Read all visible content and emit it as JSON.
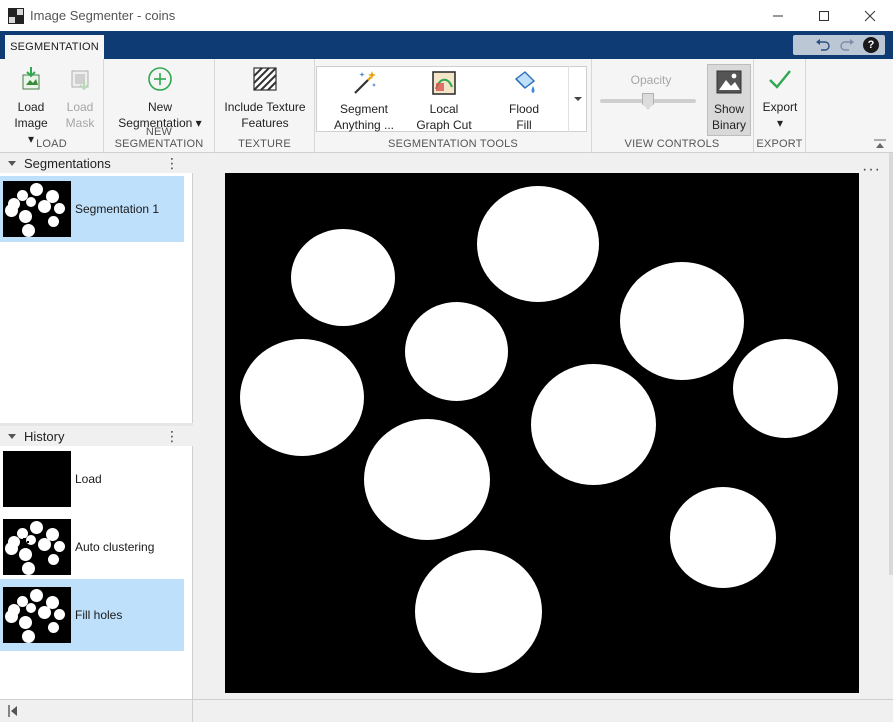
{
  "window": {
    "title": "Image Segmenter - coins"
  },
  "tabs": [
    {
      "label": "SEGMENTATION",
      "active": true
    }
  ],
  "ribbon": {
    "load": {
      "section_label": "LOAD",
      "load_image": {
        "line1": "Load",
        "line2": "Image ▾"
      },
      "load_mask": {
        "line1": "Load",
        "line2": "Mask",
        "disabled": true
      }
    },
    "new_segmentation": {
      "section_label": "NEW SEGMENTATION",
      "button": {
        "line1": "New",
        "line2": "Segmentation ▾"
      }
    },
    "texture": {
      "section_label": "TEXTURE",
      "button": {
        "line1": "Include Texture",
        "line2": "Features"
      }
    },
    "segmentation_tools": {
      "section_label": "SEGMENTATION TOOLS",
      "segment_anything": {
        "line1": "Segment",
        "line2": "Anything ..."
      },
      "local_graph_cut": {
        "line1": "Local",
        "line2": "Graph Cut"
      },
      "flood_fill": {
        "line1": "Flood",
        "line2": "Fill"
      }
    },
    "view_controls": {
      "section_label": "VIEW CONTROLS",
      "opacity_label": "Opacity",
      "opacity_value": 0.5,
      "show_binary": {
        "line1": "Show",
        "line2": "Binary",
        "active": true
      }
    },
    "export": {
      "section_label": "EXPORT",
      "button": {
        "line1": "Export",
        "line2": "▾"
      }
    }
  },
  "segmentations_panel": {
    "title": "Segmentations",
    "items": [
      {
        "label": "Segmentation 1",
        "selected": true
      }
    ]
  },
  "history_panel": {
    "title": "History",
    "items": [
      {
        "label": "Load",
        "selected": false
      },
      {
        "label": "Auto clustering",
        "selected": false
      },
      {
        "label": "Fill holes",
        "selected": true
      }
    ]
  },
  "colors": {
    "tab_strip": "#0e3b73",
    "selected_row": "#bfe0fb",
    "accent_green": "#2fa84f"
  }
}
